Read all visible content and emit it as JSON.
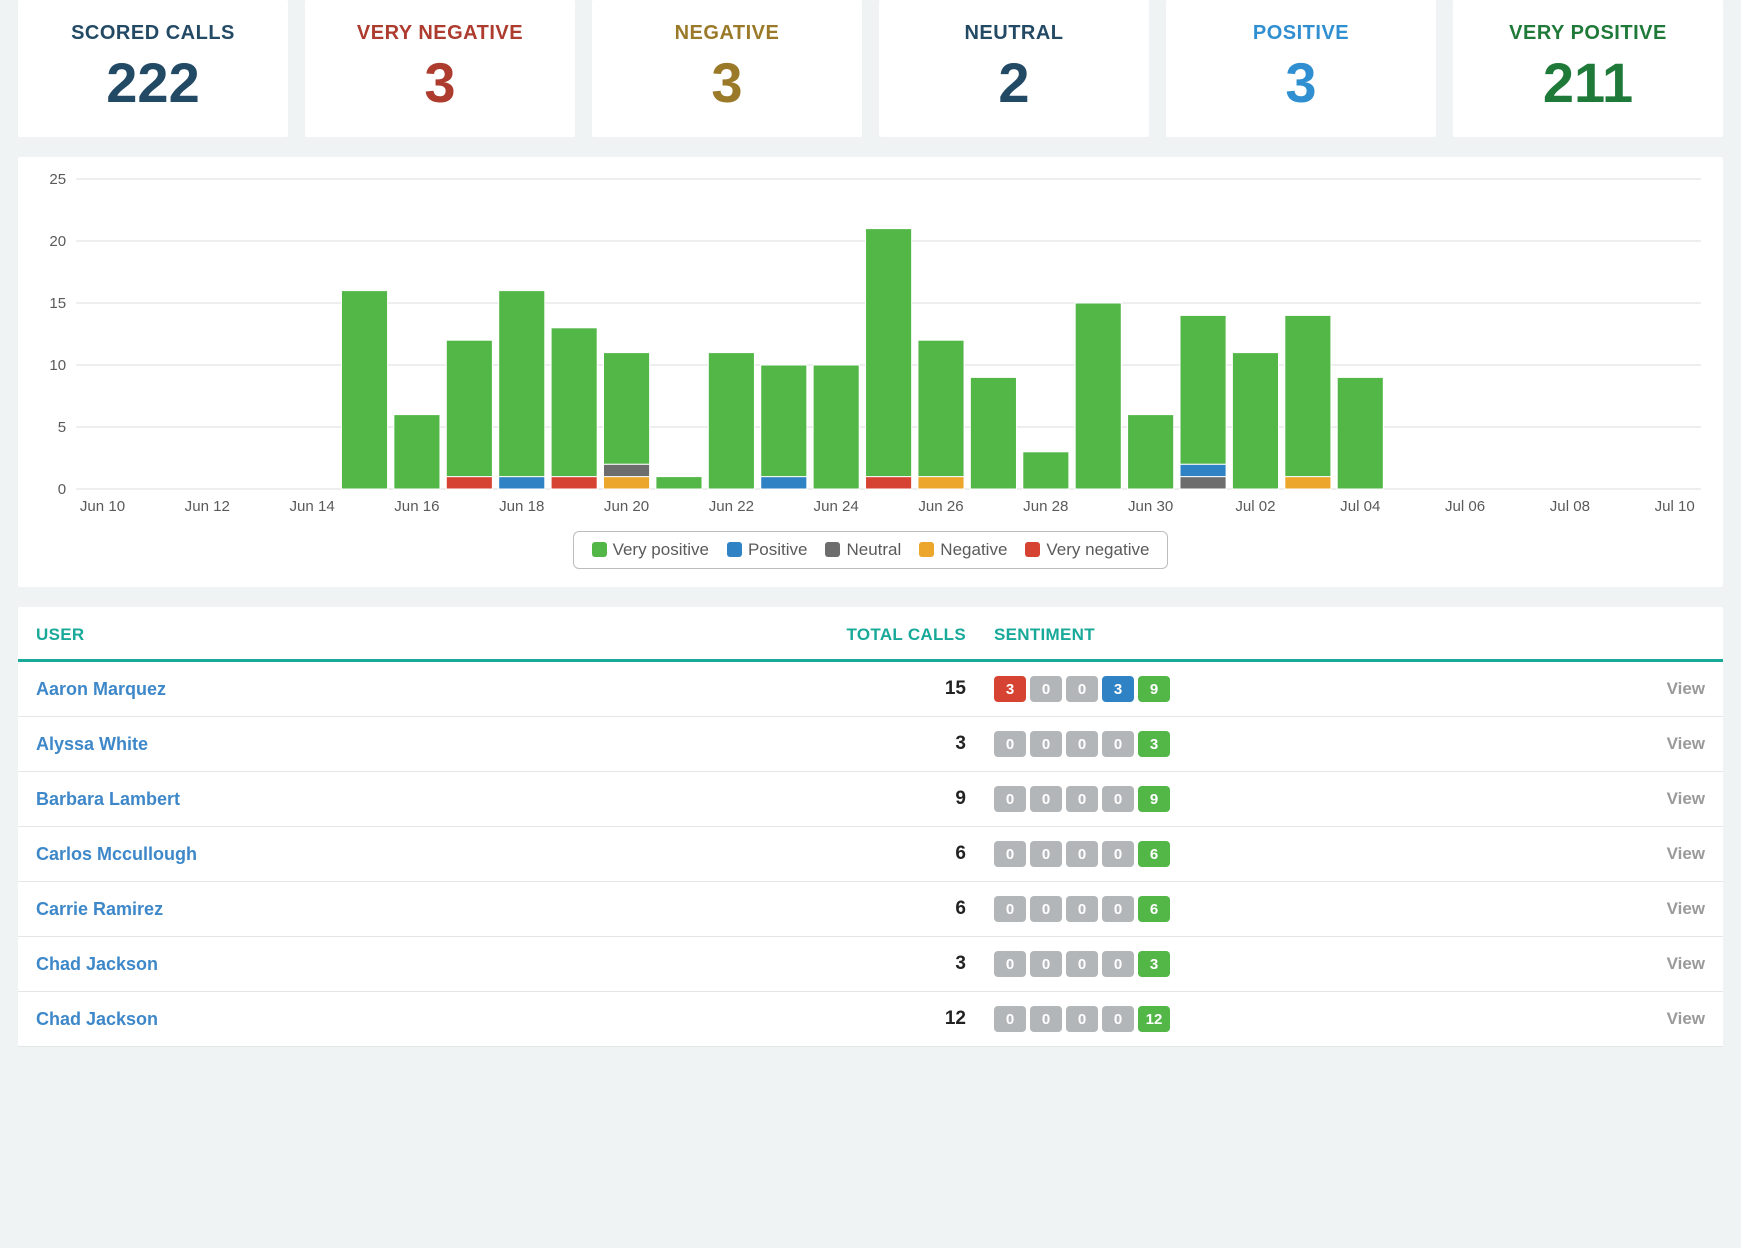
{
  "summary": {
    "scored_calls": {
      "label": "SCORED CALLS",
      "value": "222"
    },
    "very_negative": {
      "label": "VERY NEGATIVE",
      "value": "3"
    },
    "negative": {
      "label": "NEGATIVE",
      "value": "3"
    },
    "neutral": {
      "label": "NEUTRAL",
      "value": "2"
    },
    "positive": {
      "label": "POSITIVE",
      "value": "3"
    },
    "very_positive": {
      "label": "VERY POSITIVE",
      "value": "211"
    }
  },
  "chart_data": {
    "type": "bar",
    "stacked": true,
    "title": "",
    "xlabel": "",
    "ylabel": "",
    "ylim": [
      0,
      25
    ],
    "yticks": [
      0,
      5,
      10,
      15,
      20,
      25
    ],
    "categories": [
      "Jun 10",
      "Jun 11",
      "Jun 12",
      "Jun 13",
      "Jun 14",
      "Jun 15",
      "Jun 16",
      "Jun 17",
      "Jun 18",
      "Jun 19",
      "Jun 20",
      "Jun 21",
      "Jun 22",
      "Jun 23",
      "Jun 24",
      "Jun 25",
      "Jun 26",
      "Jun 27",
      "Jun 28",
      "Jun 29",
      "Jun 30",
      "Jul 01",
      "Jul 02",
      "Jul 03",
      "Jul 04",
      "Jul 05",
      "Jul 06",
      "Jul 07",
      "Jul 08",
      "Jul 09",
      "Jul 10"
    ],
    "x_tick_labels": [
      "Jun 10",
      "Jun 12",
      "Jun 14",
      "Jun 16",
      "Jun 18",
      "Jun 20",
      "Jun 22",
      "Jun 24",
      "Jun 26",
      "Jun 28",
      "Jun 30",
      "Jul 02",
      "Jul 04",
      "Jul 06",
      "Jul 08",
      "Jul 10"
    ],
    "series": [
      {
        "name": "Very positive",
        "key": "vp",
        "color": "#53b748",
        "values": [
          0,
          0,
          0,
          0,
          0,
          16,
          6,
          11,
          15,
          12,
          9,
          1,
          11,
          9,
          10,
          20,
          11,
          9,
          3,
          15,
          6,
          12,
          11,
          13,
          9,
          0,
          0,
          0,
          0,
          0,
          0
        ]
      },
      {
        "name": "Positive",
        "key": "pos",
        "color": "#2f82c4",
        "values": [
          0,
          0,
          0,
          0,
          0,
          0,
          0,
          0,
          1,
          0,
          0,
          0,
          0,
          1,
          0,
          0,
          0,
          0,
          0,
          0,
          0,
          1,
          0,
          0,
          0,
          0,
          0,
          0,
          0,
          0,
          0
        ]
      },
      {
        "name": "Neutral",
        "key": "neu",
        "color": "#6d6d6d",
        "values": [
          0,
          0,
          0,
          0,
          0,
          0,
          0,
          0,
          0,
          0,
          1,
          0,
          0,
          0,
          0,
          0,
          0,
          0,
          0,
          0,
          0,
          1,
          0,
          0,
          0,
          0,
          0,
          0,
          0,
          0,
          0
        ]
      },
      {
        "name": "Negative",
        "key": "neg",
        "color": "#eba62b",
        "values": [
          0,
          0,
          0,
          0,
          0,
          0,
          0,
          0,
          0,
          0,
          1,
          0,
          0,
          0,
          0,
          0,
          1,
          0,
          0,
          0,
          0,
          0,
          0,
          1,
          0,
          0,
          0,
          0,
          0,
          0,
          0
        ]
      },
      {
        "name": "Very negative",
        "key": "vn",
        "color": "#d64333",
        "values": [
          0,
          0,
          0,
          0,
          0,
          0,
          0,
          1,
          0,
          1,
          0,
          0,
          0,
          0,
          0,
          1,
          0,
          0,
          0,
          0,
          0,
          0,
          0,
          0,
          0,
          0,
          0,
          0,
          0,
          0,
          0
        ]
      }
    ],
    "legend_position": "bottom"
  },
  "legend": {
    "vp": "Very positive",
    "pos": "Positive",
    "neu": "Neutral",
    "neg": "Negative",
    "vn": "Very negative"
  },
  "table": {
    "headers": {
      "user": "USER",
      "total": "TOTAL CALLS",
      "sentiment": "SENTIMENT"
    },
    "view_label": "View",
    "rows": [
      {
        "user": "Aaron Marquez",
        "total": "15",
        "sent": {
          "vn": "3",
          "neg": "0",
          "neu": "0",
          "pos": "3",
          "vp": "9"
        }
      },
      {
        "user": "Alyssa White",
        "total": "3",
        "sent": {
          "vn": "0",
          "neg": "0",
          "neu": "0",
          "pos": "0",
          "vp": "3"
        }
      },
      {
        "user": "Barbara Lambert",
        "total": "9",
        "sent": {
          "vn": "0",
          "neg": "0",
          "neu": "0",
          "pos": "0",
          "vp": "9"
        }
      },
      {
        "user": "Carlos Mccullough",
        "total": "6",
        "sent": {
          "vn": "0",
          "neg": "0",
          "neu": "0",
          "pos": "0",
          "vp": "6"
        }
      },
      {
        "user": "Carrie Ramirez",
        "total": "6",
        "sent": {
          "vn": "0",
          "neg": "0",
          "neu": "0",
          "pos": "0",
          "vp": "6"
        }
      },
      {
        "user": "Chad Jackson",
        "total": "3",
        "sent": {
          "vn": "0",
          "neg": "0",
          "neu": "0",
          "pos": "0",
          "vp": "3"
        }
      },
      {
        "user": "Chad Jackson",
        "total": "12",
        "sent": {
          "vn": "0",
          "neg": "0",
          "neu": "0",
          "pos": "0",
          "vp": "12"
        }
      }
    ]
  }
}
